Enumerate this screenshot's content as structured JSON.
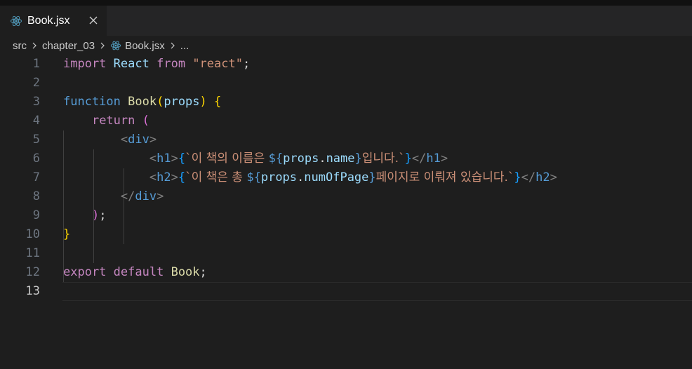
{
  "tab": {
    "filename": "Book.jsx"
  },
  "icons": {
    "tab_file": "react-icon",
    "tab_close": "close-icon",
    "breadcrumb_separator": "chevron-right-icon",
    "breadcrumb_file": "react-icon"
  },
  "breadcrumb": {
    "items": [
      "src",
      "chapter_03",
      "Book.jsx",
      "..."
    ]
  },
  "editor": {
    "current_line": 13,
    "line_numbers": [
      "1",
      "2",
      "3",
      "4",
      "5",
      "6",
      "7",
      "8",
      "9",
      "10",
      "11",
      "12",
      "13"
    ],
    "lines": {
      "l1": {
        "import": "import",
        "react_id": "React",
        "from": "from",
        "module": "\"react\"",
        "semi": ";"
      },
      "l3": {
        "function": "function",
        "name": "Book",
        "open_paren": "(",
        "param": "props",
        "close_paren": ")",
        "open_brace": "{"
      },
      "l4": {
        "return": "return",
        "open_paren": "("
      },
      "l5": {
        "lt": "<",
        "tag": "div",
        "gt": ">"
      },
      "l6": {
        "lt": "<",
        "tag_open": "h1",
        "gt": ">",
        "brace_open": "{",
        "str_start": "`이 책의 이름은 ",
        "dollar": "$",
        "interp_open": "{",
        "obj": "props",
        "dot": ".",
        "prop": "name",
        "interp_close": "}",
        "str_end": "입니다.`",
        "brace_close": "}",
        "close_lt": "</",
        "tag_close": "h1",
        "close_gt": ">"
      },
      "l7": {
        "lt": "<",
        "tag_open": "h2",
        "gt": ">",
        "brace_open": "{",
        "str_start": "`이 책은 총 ",
        "dollar": "$",
        "interp_open": "{",
        "obj": "props",
        "dot": ".",
        "prop": "numOfPage",
        "interp_close": "}",
        "str_end": "페이지로 이뤄져 있습니다.`",
        "brace_close": "}",
        "close_lt": "</",
        "tag_close": "h2",
        "close_gt": ">"
      },
      "l8": {
        "lt": "</",
        "tag": "div",
        "gt": ">"
      },
      "l9": {
        "close_paren": ")",
        "semi": ";"
      },
      "l10": {
        "close_brace": "}"
      },
      "l12": {
        "export": "export",
        "default": "default",
        "name": "Book",
        "semi": ";"
      }
    }
  },
  "colors": {
    "editor_bg": "#1e1e1e",
    "tabbar_bg": "#252526",
    "keyword": "#c586c0",
    "storage": "#569cd6",
    "variable": "#9cdcfe",
    "function": "#dcdcaa",
    "string": "#ce9178"
  }
}
